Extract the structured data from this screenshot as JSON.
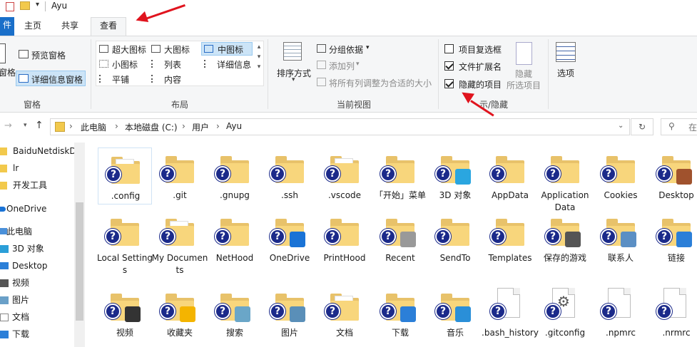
{
  "window": {
    "title": "Ayu"
  },
  "tabs": {
    "file": "件",
    "home": "主页",
    "share": "共享",
    "view": "查看"
  },
  "ribbon": {
    "panes": {
      "preview": "预览窗格",
      "details": "详细信息窗格",
      "nav_partial": "窗格",
      "group_label": "窗格"
    },
    "layout": {
      "items": [
        "超大图标",
        "大图标",
        "中图标",
        "小图标",
        "列表",
        "详细信息",
        "平铺",
        "内容"
      ],
      "selected": "中图标",
      "group_label": "布局"
    },
    "current_view": {
      "sort_by": "排序方式",
      "group_by": "分组依据",
      "add_columns": "添加列",
      "fit_columns": "将所有列调整为合适的大小",
      "group_label": "当前视图"
    },
    "show_hide": {
      "item_checkboxes": {
        "label": "项目复选框",
        "checked": false
      },
      "file_extensions": {
        "label": "文件扩展名",
        "checked": true
      },
      "hidden_items": {
        "label": "隐藏的项目",
        "checked": true
      },
      "hide_selected_1": "隐藏",
      "hide_selected_2": "所选项目",
      "group_label": "显示/隐藏",
      "group_label_visible": "示/隐藏"
    },
    "options": {
      "label": "选项"
    }
  },
  "address": {
    "crumbs": [
      "此电脑",
      "本地磁盘 (C:)",
      "用户",
      "Ayu"
    ],
    "search_placeholder": "在"
  },
  "nav": {
    "items": [
      "BaiduNetdiskD",
      "lr",
      "开发工具",
      "OneDrive",
      "此电脑",
      "3D 对象",
      "Desktop",
      "视频",
      "图片",
      "文档",
      "下载"
    ]
  },
  "files": {
    "row1": [
      ".config",
      ".git",
      ".gnupg",
      ".ssh",
      ".vscode",
      "「开始」菜单",
      "3D 对象",
      "AppData",
      "Application Data",
      "Cookies",
      "Desktop"
    ],
    "row2": [
      "Local Settings",
      "My Documents",
      "NetHood",
      "OneDrive",
      "PrintHood",
      "Recent",
      "SendTo",
      "Templates",
      "保存的游戏",
      "联系人",
      "链接"
    ],
    "row3": [
      "视频",
      "收藏夹",
      "搜索",
      "图片",
      "文档",
      "下载",
      "音乐",
      ".bash_history",
      ".gitconfig",
      ".npmrc",
      ".nrmrc"
    ]
  },
  "colors": {
    "accent": "#1a6fc9",
    "folder": "#f8d67c",
    "arrow": "#e0141e",
    "unknown_badge": "#1b2a8a"
  }
}
